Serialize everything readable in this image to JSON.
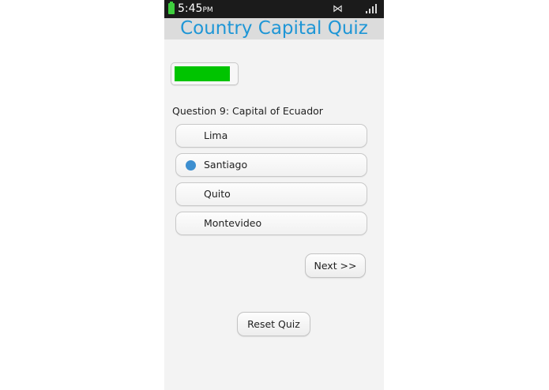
{
  "status_bar": {
    "time": "5:45",
    "ampm": "PM",
    "bluetooth_icon": "bluetooth-icon",
    "signal_icon": "signal-icon",
    "battery_icon": "battery-icon"
  },
  "app": {
    "title": "Country Capital Quiz",
    "title_color": "#1e96d6"
  },
  "progress": {
    "fraction": 0.92,
    "color": "#00c400"
  },
  "question": {
    "prefix": "Question 9:",
    "text": "Capital of Ecuador"
  },
  "options": [
    {
      "label": "Lima",
      "selected": false
    },
    {
      "label": "Santiago",
      "selected": true
    },
    {
      "label": "Quito",
      "selected": false
    },
    {
      "label": "Montevideo",
      "selected": false
    }
  ],
  "buttons": {
    "next_label": "Next >>",
    "reset_label": "Reset Quiz"
  }
}
